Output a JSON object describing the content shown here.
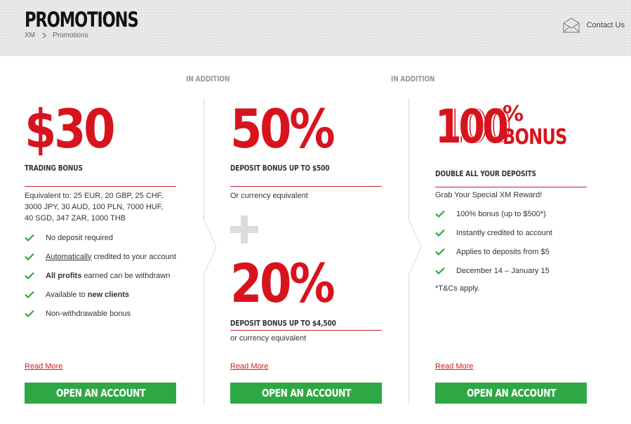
{
  "header": {
    "title": "PROMOTIONS",
    "breadcrumb": [
      "XM",
      "Promotions"
    ],
    "contact_label": "Contact Us"
  },
  "connectors": {
    "label": "IN ADDITION"
  },
  "col1": {
    "amount": "$30",
    "subtitle": "TRADING BONUS",
    "equivalent": [
      "Equivalent to: 25 EUR, 20 GBP, 25 CHF,",
      "3000 JPY, 30 AUD, 100 PLN, 7000 HUF,",
      "40 SGD, 347 ZAR, 1000 THB"
    ],
    "features": [
      {
        "pre": "",
        "u": "",
        "bold": "",
        "post": "No deposit required"
      },
      {
        "pre": "",
        "u": "Automatically",
        "bold": "",
        "post": " credited to your account"
      },
      {
        "pre": "",
        "u": "",
        "bold": "All profits",
        "post": " earned can be withdrawn"
      },
      {
        "pre": "Available to ",
        "u": "",
        "bold": "new clients",
        "post": ""
      },
      {
        "pre": "",
        "u": "",
        "bold": "",
        "post": "Non-withdrawable bonus"
      }
    ],
    "read_more": "Read More",
    "cta": "OPEN AN ACCOUNT"
  },
  "col2": {
    "pct1": "50%",
    "sub1": "DEPOSIT BONUS UP TO $500",
    "note1": "Or currency equivalent",
    "pct2": "20%",
    "sub2": "DEPOSIT BONUS UP TO $4,500",
    "note2": "or currency equivalent",
    "read_more": "Read More",
    "cta": "OPEN AN ACCOUNT"
  },
  "col3": {
    "big": "100",
    "pct": "%",
    "word": "BONUS",
    "subtitle": "DOUBLE ALL YOUR DEPOSITS",
    "intro": "Grab Your Special XM Reward!",
    "features": [
      "100% bonus (up to $500*)",
      "Instantly credited to account",
      "Applies to deposits from $5",
      "December 14 – January 15"
    ],
    "terms": "*T&Cs apply.",
    "read_more": "Read More",
    "cta": "OPEN AN ACCOUNT"
  },
  "colors": {
    "accent_red": "#d7141e",
    "cta_green": "#2ea844",
    "check_green": "#2ea844"
  }
}
